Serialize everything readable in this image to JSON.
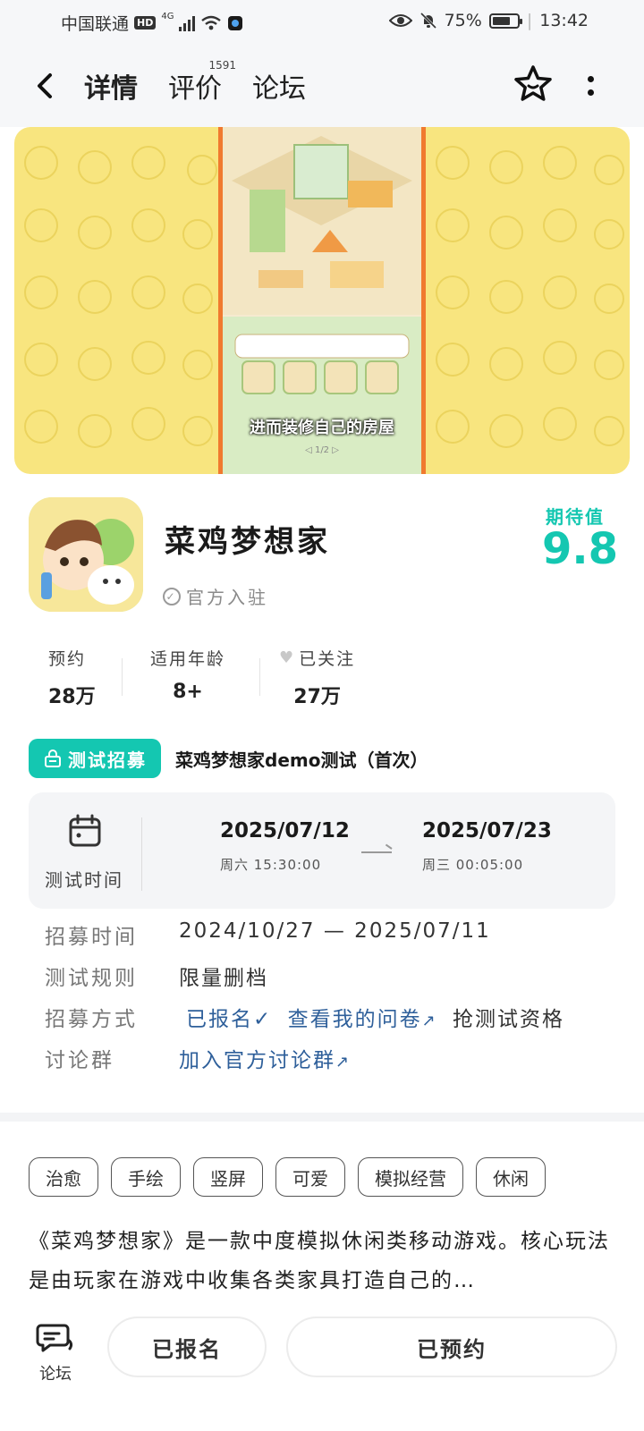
{
  "status_bar": {
    "carrier": "中国联通",
    "hd": "HD",
    "network": "4G",
    "battery_text": "75%",
    "battery_level": 0.75,
    "time": "13:42"
  },
  "header": {
    "tabs": [
      {
        "label": "详情",
        "active": true
      },
      {
        "label": "评价",
        "count": "1591"
      },
      {
        "label": "论坛"
      }
    ]
  },
  "banner": {
    "caption": "进而装修自己的房屋",
    "pager": "1/2",
    "colors": {
      "background": "#f8e57f",
      "frame": "#f07a2e"
    }
  },
  "app": {
    "name": "菜鸡梦想家",
    "official": "官方入驻",
    "expect_label": "期待值",
    "expect_value": "9.8"
  },
  "stats": [
    {
      "label": "预约",
      "value": "28万"
    },
    {
      "label": "适用年龄",
      "value": "8+"
    },
    {
      "label": "已关注",
      "value": "27万"
    }
  ],
  "recruit": {
    "badge": "测试招募",
    "title": "菜鸡梦想家demo测试（首次）",
    "test_time_label": "测试时间",
    "start_date": "2025/07/12",
    "start_sub": "周六  15:30:00",
    "end_date": "2025/07/23",
    "end_sub": "周三  00:05:00"
  },
  "info": [
    {
      "label": "招募时间",
      "value": "2024/10/27 — 2025/07/11"
    },
    {
      "label": "测试规则",
      "value": "限量删档"
    },
    {
      "label": "招募方式",
      "signed": "已报名",
      "questionnaire": "查看我的问卷",
      "qualify": "抢测试资格"
    },
    {
      "label": "讨论群",
      "value": "加入官方讨论群"
    }
  ],
  "tags": [
    "治愈",
    "手绘",
    "竖屏",
    "可爱",
    "模拟经营",
    "休闲"
  ],
  "description": "《菜鸡梦想家》是一款中度模拟休闲类移动游戏。核心玩法是由玩家在游戏中收集各类家具打造自己的…",
  "bottom_bar": {
    "forum_label": "论坛",
    "signed_label": "已报名",
    "reserved_label": "已预约"
  },
  "colors": {
    "accent": "#14c7b1",
    "link": "#2e5f9a"
  }
}
